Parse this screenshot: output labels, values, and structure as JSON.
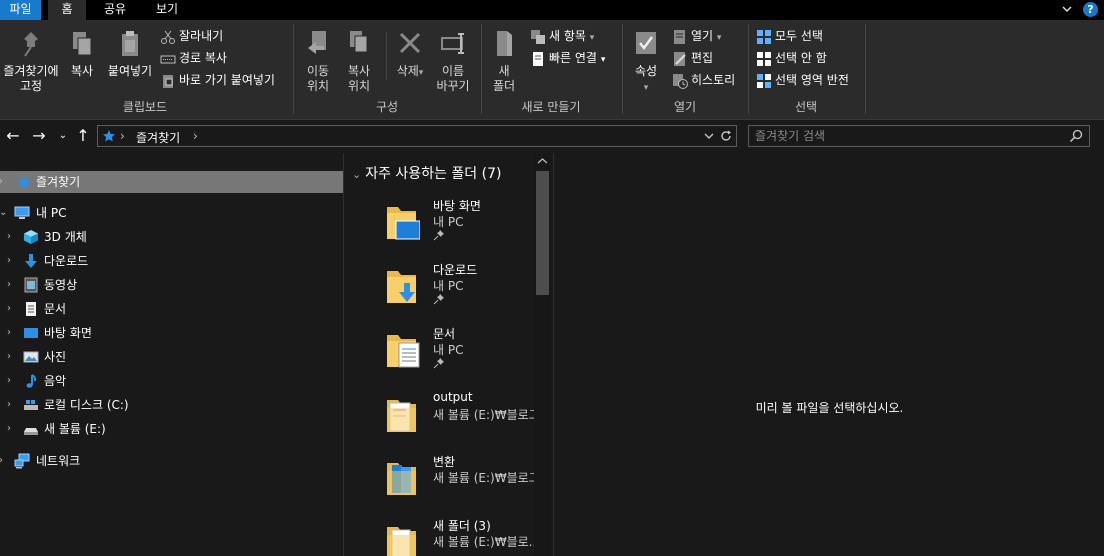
{
  "tabs": {
    "file": "파일",
    "home": "홈",
    "share": "공유",
    "view": "보기"
  },
  "help_label": "?",
  "ribbon": {
    "clipboard": {
      "group_label": "클립보드",
      "pin_label_1": "즐겨찾기에",
      "pin_label_2": "고정",
      "copy": "복사",
      "paste": "붙여넣기",
      "cut": "잘라내기",
      "copy_path": "경로 복사",
      "paste_shortcut": "바로 가기 붙여넣기"
    },
    "organize": {
      "group_label": "구성",
      "move_1": "이동",
      "move_2": "위치",
      "copyto_1": "복사",
      "copyto_2": "위치",
      "delete": "삭제",
      "rename_1": "이름",
      "rename_2": "바꾸기"
    },
    "new": {
      "group_label": "새로 만들기",
      "newfolder_1": "새",
      "newfolder_2": "폴더",
      "new_item": "새 항목",
      "easy_access": "빠른 연결"
    },
    "open": {
      "group_label": "열기",
      "properties": "속성",
      "open": "열기",
      "edit": "편집",
      "history": "히스토리"
    },
    "select": {
      "group_label": "선택",
      "select_all": "모두 선택",
      "select_none": "선택 안 함",
      "invert": "선택 영역 반전"
    }
  },
  "address": {
    "crumb": "즐겨찾기",
    "sep": "›"
  },
  "search": {
    "placeholder": "즐겨찾기 검색"
  },
  "tree": [
    {
      "label": "즐겨찾기",
      "icon": "star-icon"
    },
    {
      "label": "내 PC",
      "icon": "pc-icon"
    },
    {
      "label": "3D 개체",
      "icon": "3d-objects-icon"
    },
    {
      "label": "다운로드",
      "icon": "download-icon"
    },
    {
      "label": "동영상",
      "icon": "video-icon"
    },
    {
      "label": "문서",
      "icon": "document-icon"
    },
    {
      "label": "바탕 화면",
      "icon": "desktop-icon"
    },
    {
      "label": "사진",
      "icon": "picture-icon"
    },
    {
      "label": "음악",
      "icon": "music-icon"
    },
    {
      "label": "로컬 디스크 (C:)",
      "icon": "drive-icon"
    },
    {
      "label": "새 볼륨 (E:)",
      "icon": "drive-icon"
    },
    {
      "label": "네트워크",
      "icon": "network-icon"
    }
  ],
  "content": {
    "group_header": "자주 사용하는 폴더 (7)",
    "items": [
      {
        "name": "바탕 화면",
        "location": "내 PC",
        "icon": "desktop-folder-icon"
      },
      {
        "name": "다운로드",
        "location": "내 PC",
        "icon": "download-folder-icon"
      },
      {
        "name": "문서",
        "location": "내 PC",
        "icon": "document-folder-icon"
      },
      {
        "name": "output",
        "location": "새 볼륨 (E:)₩블로그",
        "icon": "folder-icon"
      },
      {
        "name": "변환",
        "location": "새 볼륨 (E:)₩블로그",
        "icon": "folder-icon"
      },
      {
        "name": "새 폴더 (3)",
        "location": "새 볼륨 (E:)₩블로...",
        "icon": "folder-icon"
      }
    ]
  },
  "preview": {
    "message": "미리 볼 파일을 선택하십시오."
  }
}
